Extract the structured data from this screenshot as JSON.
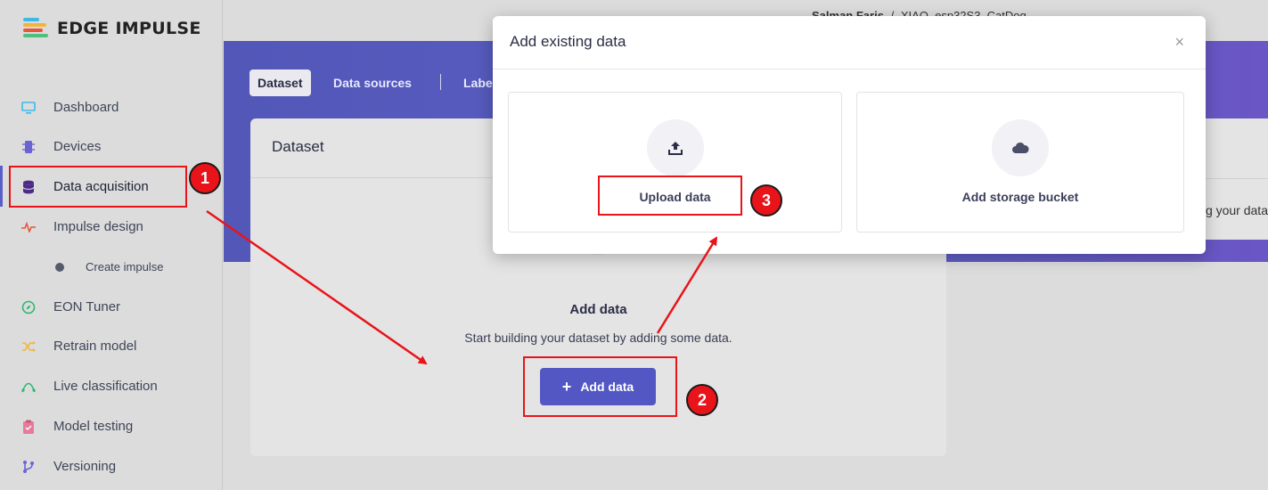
{
  "app": {
    "name": "EDGE IMPULSE"
  },
  "header": {
    "user": "Salman Faris",
    "separator": "/",
    "project": "XIAO_esp32S3_CatDog"
  },
  "sidebar": {
    "items": [
      {
        "label": "Dashboard",
        "icon": "monitor-icon"
      },
      {
        "label": "Devices",
        "icon": "chip-icon"
      },
      {
        "label": "Data acquisition",
        "icon": "database-icon"
      },
      {
        "label": "Impulse design",
        "icon": "pulse-icon"
      },
      {
        "label": "Create impulse",
        "icon": "dot-icon"
      },
      {
        "label": "EON Tuner",
        "icon": "compass-icon"
      },
      {
        "label": "Retrain model",
        "icon": "shuffle-icon"
      },
      {
        "label": "Live classification",
        "icon": "curve-icon"
      },
      {
        "label": "Model testing",
        "icon": "clipboard-icon"
      },
      {
        "label": "Versioning",
        "icon": "branch-icon"
      }
    ]
  },
  "tabs": [
    {
      "label": "Dataset"
    },
    {
      "label": "Data sources"
    },
    {
      "label": "Labe"
    }
  ],
  "card": {
    "title": "Dataset",
    "empty_title": "Add data",
    "empty_subtitle": "Start building your dataset by adding some data.",
    "add_button": "Add data"
  },
  "right_panel": {
    "text": "g your data"
  },
  "modal": {
    "title": "Add existing data",
    "close": "×",
    "options": [
      {
        "label": "Upload data",
        "icon": "upload-icon"
      },
      {
        "label": "Add storage bucket",
        "icon": "cloud-icon"
      }
    ]
  },
  "annotations": {
    "step1": "1",
    "step2": "2",
    "step3": "3",
    "color": "#e8141a"
  },
  "colors": {
    "accent": "#5257c4",
    "hero": "#5257b8"
  }
}
